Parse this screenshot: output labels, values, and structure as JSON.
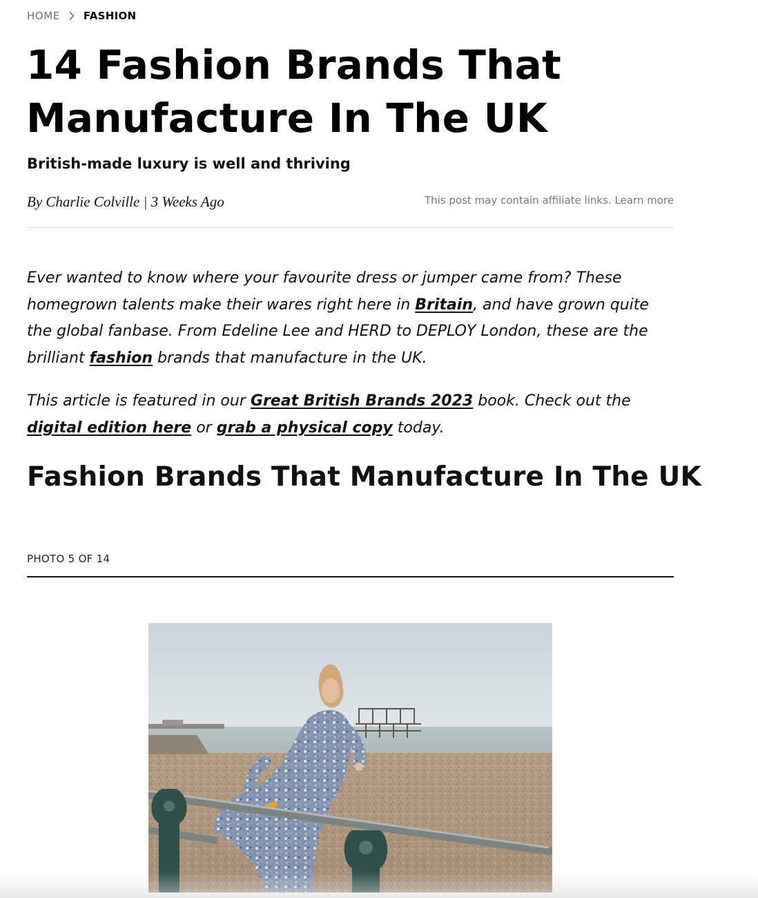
{
  "breadcrumb": {
    "home": "HOME",
    "current": "FASHION"
  },
  "article": {
    "title": "14 Fashion Brands That Manufacture In The UK",
    "subtitle": "British-made luxury is well and thriving",
    "byline": {
      "by": "By",
      "author": "Charlie Colville",
      "separator": "|",
      "date": "3 Weeks Ago"
    },
    "affiliate": {
      "text": "This post may contain affiliate links.",
      "link": "Learn more"
    },
    "intro": {
      "part1": "Ever wanted to know where your favourite dress or jumper came from? These homegrown talents make their wares right here in ",
      "link1": "Britain",
      "part2": ", and have grown quite the global fanbase. From Edeline Lee and HERD to DEPLOY London, these are the brilliant ",
      "link2": "fashion",
      "part3": " brands that manufacture in the UK."
    },
    "featured": {
      "part1": "This article is featured in our ",
      "link1": "Great British Brands 2023",
      "part2": " book. Check out the ",
      "link2": "digital edition here",
      "part3": " or ",
      "link3": "grab a physical copy",
      "part4": " today."
    },
    "section_title": "Fashion Brands That Manufacture In The UK",
    "photo_counter": "PHOTO 5 OF 14"
  },
  "icons": {
    "breadcrumb_separator": "chevron-right-icon"
  }
}
